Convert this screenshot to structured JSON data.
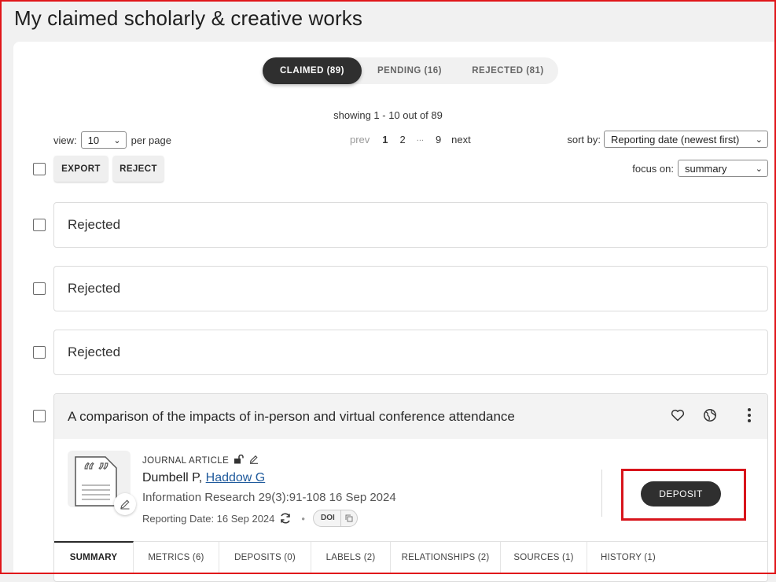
{
  "page": {
    "title": "My claimed scholarly & creative works"
  },
  "status_tabs": [
    {
      "label": "CLAIMED (89)",
      "active": true
    },
    {
      "label": "PENDING (16)",
      "active": false
    },
    {
      "label": "REJECTED (81)",
      "active": false
    }
  ],
  "listing": {
    "showing": "showing 1 - 10 out of 89",
    "view_label": "view:",
    "per_page_value": "10",
    "per_page_suffix": "per page",
    "pager": {
      "prev": "prev",
      "pages": [
        "1",
        "2",
        "...",
        "9"
      ],
      "current": "1",
      "next": "next"
    },
    "sort_label": "sort by:",
    "sort_value": "Reporting date (newest first)",
    "focus_label": "focus on:",
    "focus_value": "summary"
  },
  "actions": {
    "export": "EXPORT",
    "reject": "REJECT"
  },
  "rejected_items": [
    {
      "label": "Rejected"
    },
    {
      "label": "Rejected"
    },
    {
      "label": "Rejected"
    }
  ],
  "work": {
    "title": "A comparison of the impacts of in-person and virtual conference attendance",
    "type": "JOURNAL ARTICLE",
    "author_plain": "Dumbell P, ",
    "author_link": "Haddow G",
    "citation": "Information Research 29(3):91-108 16 Sep 2024",
    "reporting_date": "Reporting Date: 16 Sep 2024",
    "doi_label": "DOI",
    "deposit_label": "DEPOSIT",
    "tabs": [
      {
        "label": "SUMMARY",
        "active": true
      },
      {
        "label": "METRICS (6)"
      },
      {
        "label": "DEPOSITS (0)"
      },
      {
        "label": "LABELS (2)"
      },
      {
        "label": "RELATIONSHIPS (2)"
      },
      {
        "label": "SOURCES (1)"
      },
      {
        "label": "HISTORY (1)"
      }
    ]
  },
  "colors": {
    "accent_dark": "#2f2f2f",
    "status_dot": "#17606b",
    "highlight": "#d8141b",
    "link": "#1f5a9c"
  },
  "icons": [
    "heart-icon",
    "globe-icon",
    "more-vertical-icon",
    "lock-open-icon",
    "pencil-icon",
    "refresh-icon",
    "copy-icon",
    "quote-document-icon",
    "chevron-down-icon"
  ]
}
